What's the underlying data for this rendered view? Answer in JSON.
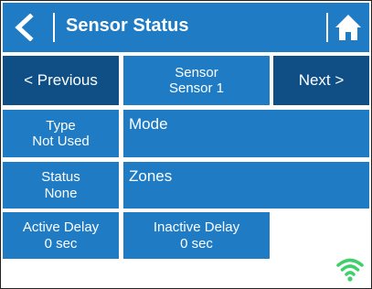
{
  "header": {
    "title": "Sensor Status",
    "back_icon": "back-chevron-icon",
    "home_icon": "home-icon"
  },
  "nav": {
    "previous_label": "< Previous",
    "sensor_label": "Sensor",
    "sensor_value": "Sensor 1",
    "next_label": "Next >"
  },
  "fields": {
    "type_label": "Type",
    "type_value": "Not Used",
    "mode_label": "Mode",
    "status_label": "Status",
    "status_value": "None",
    "zones_label": "Zones",
    "active_delay_label": "Active Delay",
    "active_delay_value": "0 sec",
    "inactive_delay_label": "Inactive Delay",
    "inactive_delay_value": "0 sec"
  },
  "status_icons": {
    "wifi_icon": "wifi-icon"
  },
  "colors": {
    "tile_blue": "#1f7bc4",
    "tile_dark_blue": "#0f4f86",
    "wifi_green": "#3fcf6b",
    "text": "#ffffff"
  }
}
